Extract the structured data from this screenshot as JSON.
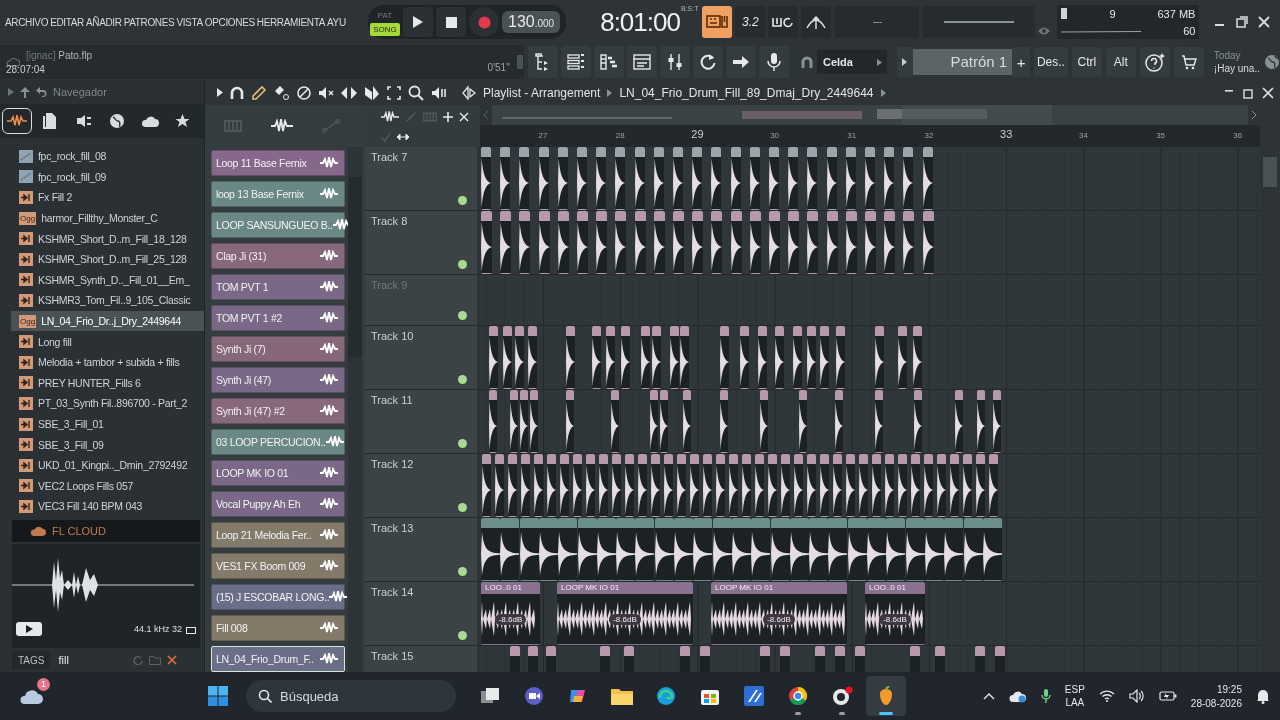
{
  "menu": [
    "ARCHIVO",
    "EDITAR",
    "AÑADIR",
    "PATRONES",
    "VISTA",
    "OPCIONES",
    "HERRAMIENTA",
    "AYU"
  ],
  "transport": {
    "modes": [
      {
        "label": "PAT",
        "selected": false
      },
      {
        "label": "SONG",
        "selected": true
      }
    ],
    "tempo": "130",
    "tempo_fraction": ".000"
  },
  "clock": {
    "time": "8:01:00",
    "format": "B:S:T"
  },
  "tool_buttons": [
    {
      "kind": "keys",
      "on": true
    },
    {
      "kind": "text",
      "label": "3.2",
      "on": false
    },
    {
      "kind": "loop",
      "on": false
    },
    {
      "kind": "metronome",
      "on": false
    }
  ],
  "hint": "---",
  "monitor": {
    "cpu": "9",
    "memory": "637 MB",
    "polyphony": "60"
  },
  "project": {
    "user": "[ignac]",
    "file": "Pato.flp",
    "time": "28:07:04",
    "duration": "0'51''"
  },
  "snap": "Celda",
  "pattern": {
    "name": "Patrón 1",
    "add": "+"
  },
  "buttons": [
    "Des..",
    "Ctrl",
    "Alt"
  ],
  "news": {
    "title": "Today",
    "text": "¡Hay una.."
  },
  "browser": {
    "title": "Navegador",
    "tabs": [
      {
        "kind": "all",
        "selected": true
      },
      {
        "kind": "files",
        "selected": false
      },
      {
        "kind": "plugins",
        "selected": false
      },
      {
        "kind": "web",
        "selected": false
      },
      {
        "kind": "cloud",
        "selected": false
      },
      {
        "kind": "star",
        "selected": false
      }
    ],
    "items": [
      {
        "kind": "fpc",
        "name": "fpc_rock_fill_08",
        "selected": false
      },
      {
        "kind": "fpc",
        "name": "fpc_rock_fill_09",
        "selected": false
      },
      {
        "kind": "loop",
        "name": "Fx Fill 2",
        "selected": false
      },
      {
        "kind": "ogg",
        "badge": "Ogg",
        "name": "harmor_Fillthy_Monster_C",
        "selected": false
      },
      {
        "kind": "loop",
        "name": "KSHMR_Short_D..m_Fill_18_128",
        "selected": false
      },
      {
        "kind": "loop",
        "name": "KSHMR_Short_D..m_Fill_25_128",
        "selected": false
      },
      {
        "kind": "loop",
        "name": "KSHMR_Synth_D.._Fill_01__Em_",
        "selected": false
      },
      {
        "kind": "loop",
        "name": "KSHMR3_Tom_Fil..9_105_Classic",
        "selected": false
      },
      {
        "kind": "ogg",
        "badge": "Ogg",
        "name": "LN_04_Frio_Dr..j_Dry_2449644",
        "selected": true
      },
      {
        "kind": "loop",
        "name": "Long fill",
        "selected": false
      },
      {
        "kind": "loop",
        "name": "Melodia + tambor + subida + fills",
        "selected": false
      },
      {
        "kind": "loop",
        "name": "PREY HUNTER_Fills 6",
        "selected": false
      },
      {
        "kind": "loop",
        "name": "PT_03_Synth Fil..896700 - Part_2",
        "selected": false
      },
      {
        "kind": "loop",
        "name": "SBE_3_Fill_01",
        "selected": false
      },
      {
        "kind": "loop",
        "name": "SBE_3_Fill_09",
        "selected": false
      },
      {
        "kind": "loop",
        "name": "UKD_01_Kingpi.._Dmin_2792492",
        "selected": false
      },
      {
        "kind": "loop",
        "name": "VEC2 Loops Fills 057",
        "selected": false
      },
      {
        "kind": "loop",
        "name": "VEC3 Fill 140 BPM 043",
        "selected": false
      }
    ],
    "cloud": "FL CLOUD",
    "preview_info": "44.1 kHz 32",
    "tags": {
      "label": "TAGS",
      "value": "fill"
    }
  },
  "playlist": {
    "title": "Playlist - Arrangement",
    "clip_name": "LN_04_Frio_Drum_Fill_89_Dmaj_Dry_2449644",
    "bars": [
      "27",
      "28",
      "29",
      "30",
      "31",
      "32",
      "33",
      "34",
      "35",
      "36"
    ],
    "picker": [
      {
        "name": "Loop 11 Base Fernix",
        "color": "#86698a",
        "selected": false
      },
      {
        "name": "loop 13 Base Fernix",
        "color": "#6a8885",
        "selected": false
      },
      {
        "name": "LOOP SANSUNGUEO B..",
        "color": "#6a8885",
        "selected": false
      },
      {
        "name": "Clap Ji (31)",
        "color": "#87687c",
        "selected": false
      },
      {
        "name": "TOM PVT 1",
        "color": "#7a6886",
        "selected": false
      },
      {
        "name": "TOM PVT 1 #2",
        "color": "#7a6886",
        "selected": false
      },
      {
        "name": "Synth Ji (7)",
        "color": "#87687a",
        "selected": false
      },
      {
        "name": "Synth Ji (47)",
        "color": "#7a6886",
        "selected": false
      },
      {
        "name": "Synth Ji (47) #2",
        "color": "#87687c",
        "selected": false
      },
      {
        "name": "03 LOOP PERCUCION..",
        "color": "#6a8885",
        "selected": false
      },
      {
        "name": "LOOP MK IO 01",
        "color": "#7a6886",
        "selected": false
      },
      {
        "name": "Vocal Puppy Ah Eh",
        "color": "#7a6886",
        "selected": false
      },
      {
        "name": "Loop 21 Melodia Fer..",
        "color": "#837a6a",
        "selected": false
      },
      {
        "name": "VES1 FX Boom 009",
        "color": "#837a6a",
        "selected": false
      },
      {
        "name": "(15) J ESCOBAR LONG..",
        "color": "#6a6e86",
        "selected": false
      },
      {
        "name": "Fill 008",
        "color": "#837a6a",
        "selected": false
      },
      {
        "name": "LN_04_Frio_Drum_F..",
        "color": "#6a6e86",
        "selected": true
      }
    ],
    "tracks": [
      {
        "name": "Track 7",
        "enabled": true,
        "disabled": false,
        "color": "#9aa6a9"
      },
      {
        "name": "Track 8",
        "enabled": true,
        "disabled": false,
        "color": "#b898ad"
      },
      {
        "name": "Track 9",
        "enabled": true,
        "disabled": true
      },
      {
        "name": "Track 10",
        "enabled": true,
        "disabled": false,
        "color": "#b898ad"
      },
      {
        "name": "Track 11",
        "enabled": true,
        "disabled": false,
        "color": "#b898ad"
      },
      {
        "name": "Track 12",
        "enabled": true,
        "disabled": false,
        "color": "#b898ad"
      },
      {
        "name": "Track 13",
        "enabled": true,
        "disabled": false,
        "color": "#6c8e8a"
      },
      {
        "name": "Track 14",
        "enabled": true,
        "disabled": false,
        "color": "#8a7190",
        "clips": [
          {
            "label": "LOO..0 01",
            "gain": "-8.6dB"
          },
          {
            "label": "LOOP MK IO 01",
            "gain": "-8.6dB"
          },
          {
            "label": "LOOP MK IO 01",
            "gain": "-8.6dB"
          },
          {
            "label": "LOO..0 01",
            "gain": "-8.6dB"
          }
        ]
      },
      {
        "name": "Track 15",
        "disabled": false,
        "color": "#b898ad"
      }
    ]
  },
  "taskbar": {
    "weather_badge": "1",
    "search_placeholder": "Búsqueda",
    "apps": [
      {
        "kind": "windows",
        "running": false,
        "active": false
      },
      {
        "kind": "squares",
        "running": false,
        "active": false
      },
      {
        "kind": "camera",
        "running": false,
        "active": false
      },
      {
        "kind": "swirl",
        "running": false,
        "active": false
      },
      {
        "kind": "folder",
        "running": false,
        "active": false
      },
      {
        "kind": "wave",
        "running": false,
        "active": false
      },
      {
        "kind": "bag",
        "running": false,
        "active": false
      },
      {
        "kind": "tile",
        "running": false,
        "active": false
      },
      {
        "kind": "circle",
        "running": true,
        "active": false
      },
      {
        "kind": "ring",
        "running": true,
        "active": false
      },
      {
        "kind": "fruit",
        "running": true,
        "active": true
      }
    ],
    "language": "ESP",
    "layout": "LAA",
    "time": "19:25",
    "date": "28-08-2026"
  }
}
